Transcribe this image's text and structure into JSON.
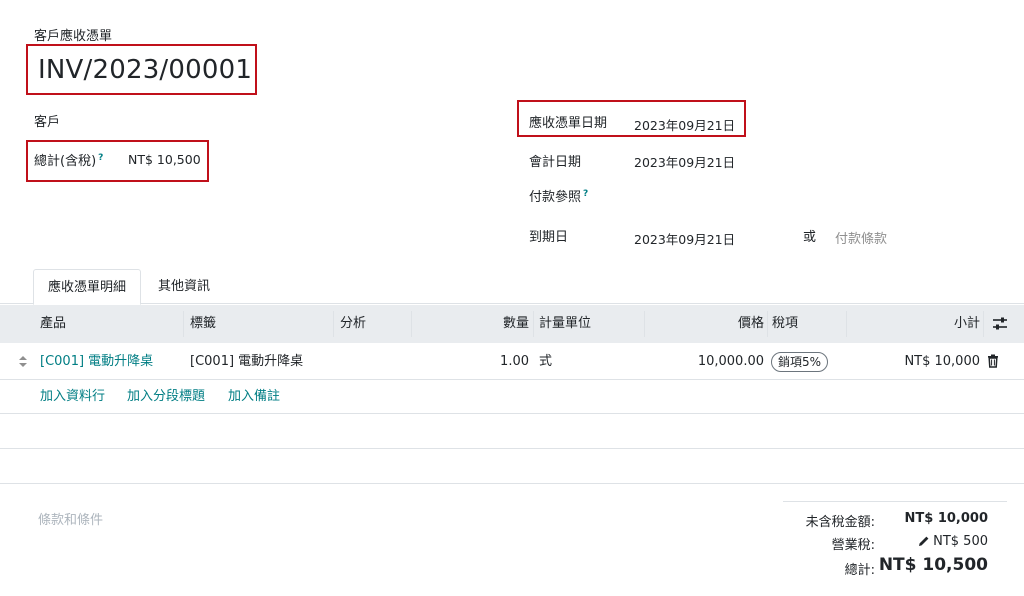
{
  "header": {
    "doc_type": "客戶應收憑單",
    "number": "INV/2023/00001"
  },
  "fields": {
    "customer_label": "客戶",
    "total_label": "總計(含稅)",
    "total_value": "NT$ 10,500",
    "invoice_date_label": "應收憑單日期",
    "invoice_date_value": "2023年09月21日",
    "accounting_date_label": "會計日期",
    "accounting_date_value": "2023年09月21日",
    "payment_ref_label": "付款參照",
    "due_date_label": "到期日",
    "due_date_value": "2023年09月21日",
    "or_text": "或",
    "payment_terms_placeholder": "付款條款",
    "help_mark": "?"
  },
  "tabs": [
    {
      "label": "應收憑單明細",
      "active": true
    },
    {
      "label": "其他資訊",
      "active": false
    }
  ],
  "table": {
    "headers": {
      "product": "產品",
      "label": "標籤",
      "analytic": "分析",
      "quantity": "數量",
      "uom": "計量單位",
      "price": "價格",
      "taxes": "稅項",
      "subtotal": "小計"
    },
    "rows": [
      {
        "product": "[C001] 電動升降桌",
        "label": "[C001] 電動升降桌",
        "analytic": "",
        "quantity": "1.00",
        "uom": "式",
        "price": "10,000.00",
        "tax": "銷項5%",
        "subtotal": "NT$ 10,000"
      }
    ],
    "add_links": {
      "add_line": "加入資料行",
      "add_section": "加入分段標題",
      "add_note": "加入備註"
    }
  },
  "footer": {
    "terms_placeholder": "條款和條件",
    "untaxed_label": "未含稅金額:",
    "untaxed_value": "NT$ 10,000",
    "tax_label": "營業稅:",
    "tax_value": "NT$ 500",
    "total_label": "總計:",
    "total_value": "NT$ 10,500"
  },
  "colors": {
    "link": "#017e84",
    "highlight": "#c0101a",
    "header_bg": "#e9ecef"
  }
}
